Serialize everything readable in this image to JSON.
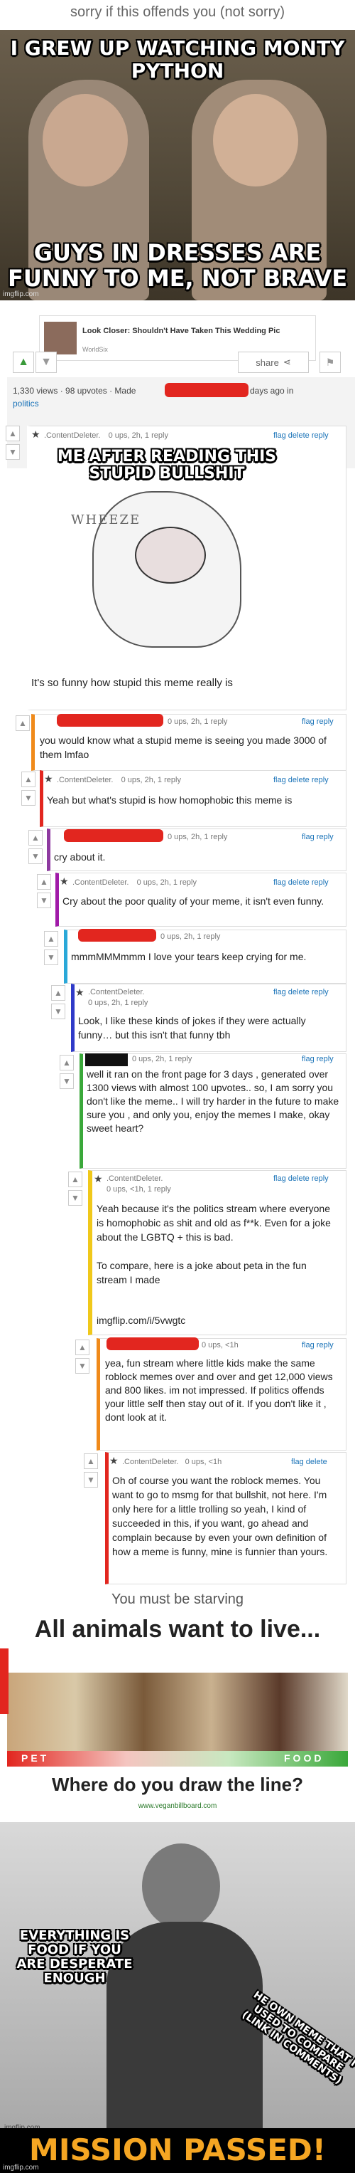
{
  "post": {
    "title": "sorry if this offends you (not sorry)",
    "share": "share",
    "stats_prefix": "1,330 views · 98 upvotes · Made",
    "stats_suffix": "days ago in",
    "stream": "politics"
  },
  "meme1": {
    "top": "I GREW UP WATCHING MONTY PYTHON",
    "bottom": "GUYS IN DRESSES ARE FUNNY TO ME, NOT BRAVE"
  },
  "watermark": "imgflip.com",
  "ad": {
    "title": "Look Closer: Shouldn't Have Taken This Wedding Pic",
    "source": "WorldSix"
  },
  "icons": {
    "up": "▲",
    "up_gray": "▲",
    "down": "▼",
    "share": "⋖",
    "flag": "⚑",
    "star": "★"
  },
  "meme_wheeze": {
    "caption": "ME AFTER READING THIS STUPID BULLSHIT",
    "sound": "WHEEZE"
  },
  "comments": [
    {
      "user": ".ContentDeleter.",
      "info": "0 ups, 2h, 1 reply",
      "actions": "flag delete reply",
      "text": "It's so funny how stupid this meme really is"
    },
    {
      "info": "0 ups, 2h, 1 reply",
      "actions": "flag reply",
      "text": "you would know what a stupid meme is seeing you made 3000 of them lmfao"
    },
    {
      "user": ".ContentDeleter.",
      "info": "0 ups, 2h, 1 reply",
      "actions": "flag delete reply",
      "text": "Yeah but what's stupid is how homophobic this meme is"
    },
    {
      "info": "0 ups, 2h, 1 reply",
      "actions": "flag reply",
      "text": "cry about it."
    },
    {
      "user": ".ContentDeleter.",
      "info": "0 ups, 2h, 1 reply",
      "actions": "flag delete reply",
      "text": "Cry about the poor quality of your meme, it isn't even funny."
    },
    {
      "info": "0 ups, 2h, 1 reply",
      "text": "mmmMMMmmm I love your tears keep crying for me."
    },
    {
      "user": ".ContentDeleter.",
      "info": "0 ups, 2h, 1 reply",
      "actions": "flag delete reply",
      "text": "Look, I like these kinds of jokes if they were actually funny… but this isn't that funny tbh"
    },
    {
      "info": "0 ups, 2h, 1 reply",
      "actions": "flag reply",
      "text": "well it ran on the front page for 3 days , generated over 1300 views with almost 100 upvotes.. so, I am sorry you don't like the meme.. I will try harder in the future to make sure you , and only you, enjoy the memes I make, okay sweet heart?"
    },
    {
      "user": ".ContentDeleter.",
      "info": "0 ups, <1h, 1 reply",
      "actions": "flag delete reply",
      "text": "Yeah because it's the politics stream where everyone is homophobic as shit and old as f**k. Even for a joke about the LGBTQ + this is bad.\n\nTo compare, here is a joke about peta in the fun stream I made",
      "link": "imgflip.com/i/5vwgtc"
    },
    {
      "info": "0 ups, <1h",
      "actions": "flag reply",
      "text": "yea, fun stream where little kids make the same roblock memes over and over and get 12,000 views and 800 likes. im not impressed. If politics offends your little self then stay out of it. If you don't like it , dont look at it."
    },
    {
      "user": ".ContentDeleter.",
      "info": "0 ups, <1h",
      "actions": "flag delete",
      "text": "Oh of course you want the roblock memes. You want to go to msmg for that bullshit, not here. I'm only here for a little trolling so yeah, I kind of succeeded in this, if you want, go ahead and complain because by even your own definition of how a meme is funny, mine is funnier than yours."
    }
  ],
  "captions": {
    "starving": "You must be starving"
  },
  "meme_vegan": {
    "headline": "All animals want to live...",
    "pet": "PET",
    "food": "FOOD",
    "question": "Where do you draw the line?",
    "site": "www.veganbillboard.com"
  },
  "meme_rdj": {
    "caption": "EVERYTHING IS FOOD IF YOU ARE DESPERATE ENOUGH",
    "side": "HE OWN MEME THAT I USED TO COMPARE (LINK IN COMMENTS)"
  },
  "mission": {
    "text": "MISSION PASSED!"
  }
}
